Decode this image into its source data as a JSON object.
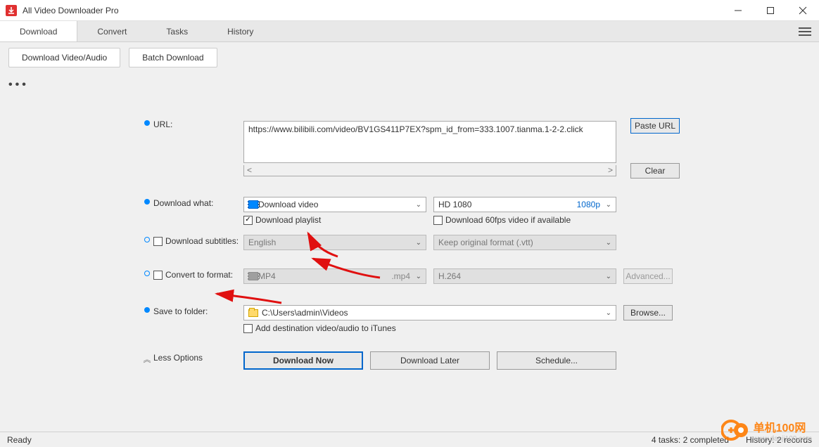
{
  "titlebar": {
    "app_name": "All Video Downloader Pro"
  },
  "tabs": {
    "download": "Download",
    "convert": "Convert",
    "tasks": "Tasks",
    "history": "History"
  },
  "subbar": {
    "dl_va": "Download Video/Audio",
    "batch": "Batch Download"
  },
  "url": {
    "label": "URL:",
    "value": "https://www.bilibili.com/video/BV1GS411P7EX?spm_id_from=333.1007.tianma.1-2-2.click",
    "paste": "Paste URL",
    "clear": "Clear"
  },
  "dl_what": {
    "label": "Download what:",
    "type": "Download video",
    "quality_name": "HD 1080",
    "quality_tag": "1080p",
    "playlist": "Download playlist",
    "sixtyfps": "Download 60fps video if available"
  },
  "subs": {
    "label": "Download subtitles:",
    "lang": "English",
    "format": "Keep original format (.vtt)"
  },
  "convert": {
    "label": "Convert to format:",
    "container": "MP4",
    "ext": ".mp4",
    "codec": "H.264",
    "advanced": "Advanced..."
  },
  "save": {
    "label": "Save to folder:",
    "path": "C:\\Users\\admin\\Videos",
    "browse": "Browse...",
    "itunes": "Add destination video/audio to iTunes"
  },
  "less": {
    "label": "Less Options"
  },
  "actions": {
    "now": "Download Now",
    "later": "Download Later",
    "schedule": "Schedule..."
  },
  "status": {
    "ready": "Ready",
    "tasks": "4 tasks: 2 completed",
    "history": "History: 2 records"
  },
  "watermark": {
    "brand": "单机100网",
    "sub": "www.danji100.com"
  }
}
